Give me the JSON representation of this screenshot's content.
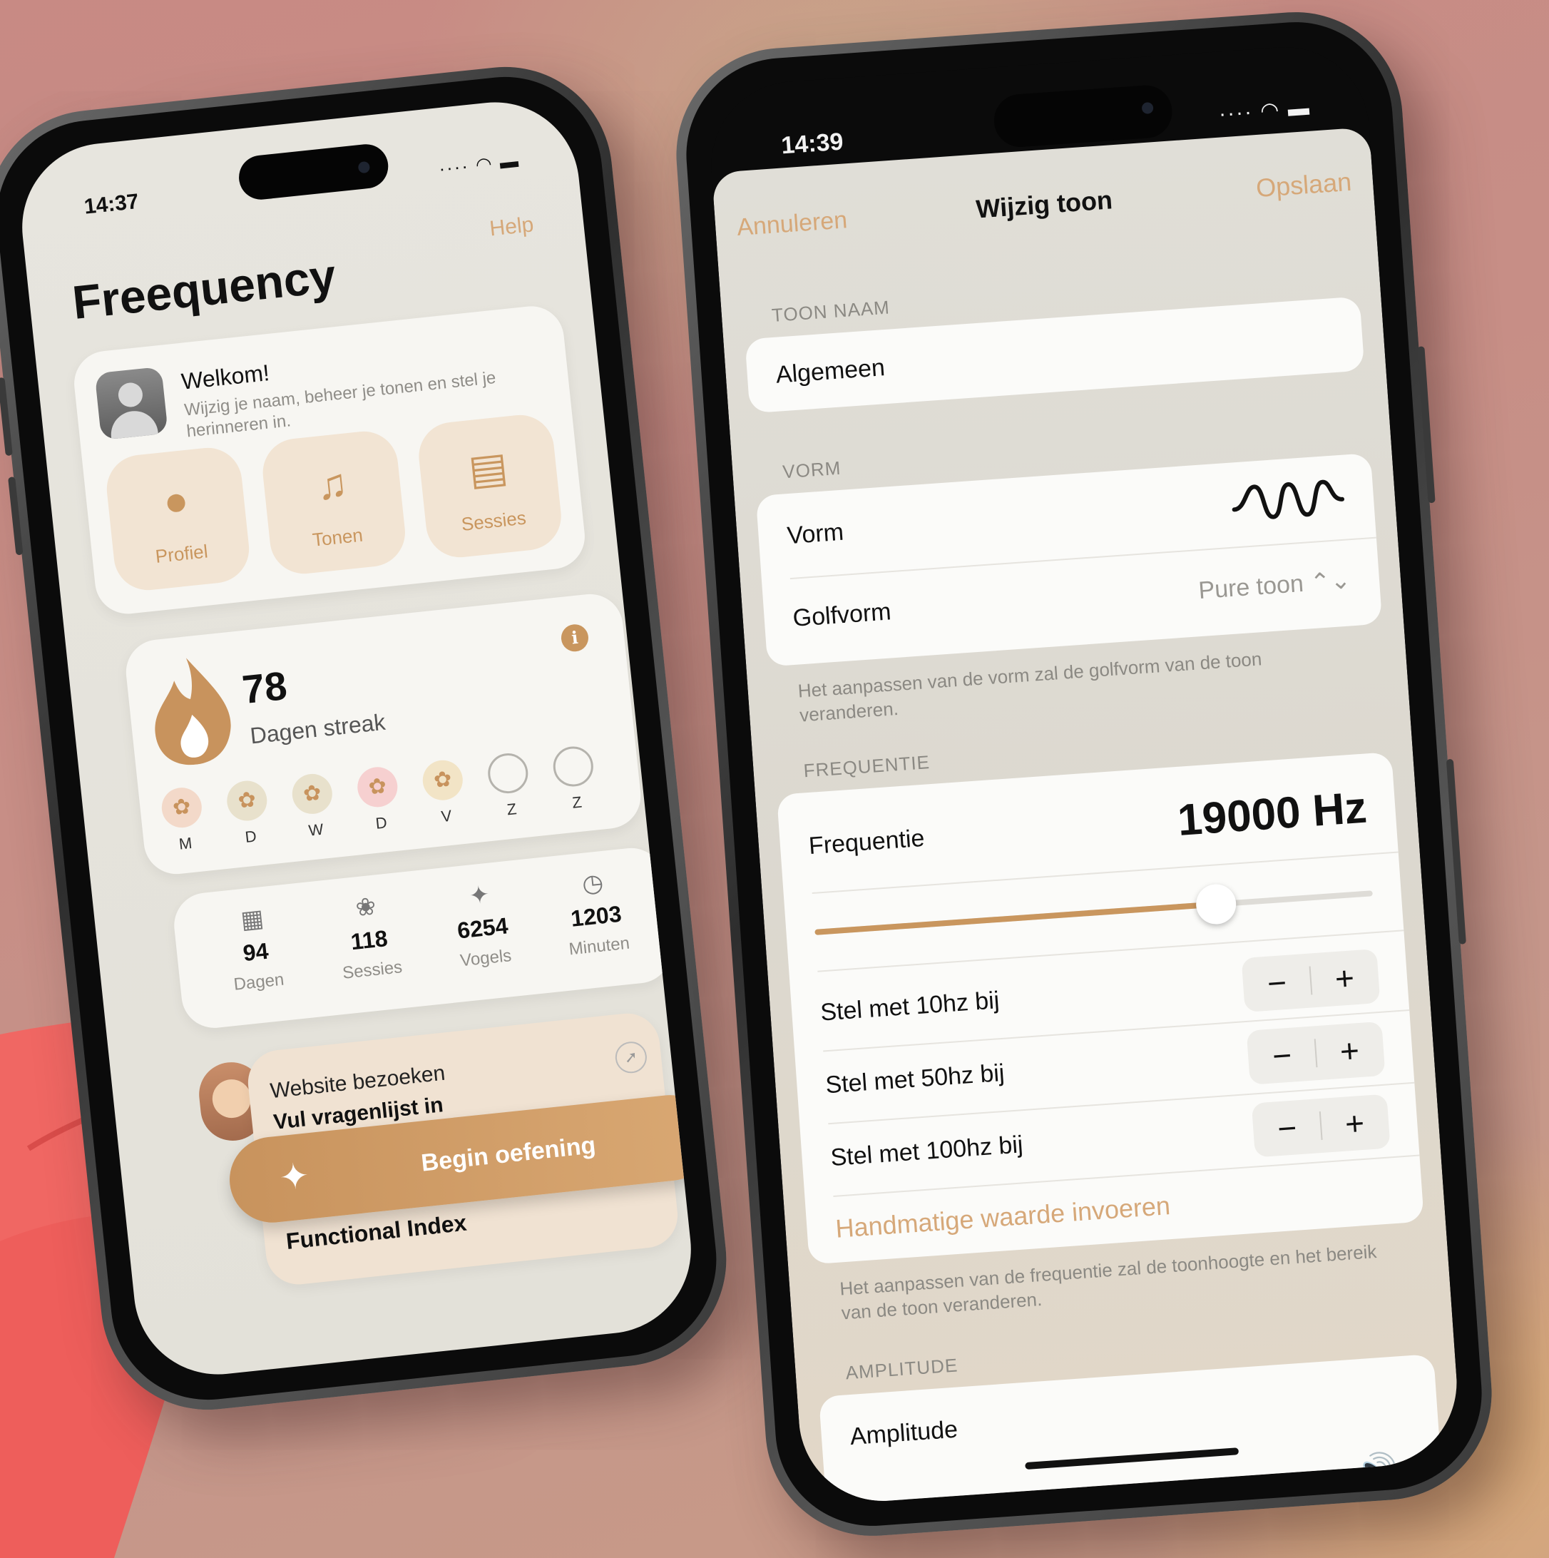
{
  "left_phone": {
    "status_time": "14:37",
    "help_label": "Help",
    "app_title": "Freequency",
    "welcome": {
      "title": "Welkom!",
      "subtitle": "Wijzig je naam, beheer je tonen en stel je herinneren in."
    },
    "tiles": [
      {
        "label": "Profiel",
        "icon": "person-icon"
      },
      {
        "label": "Tonen",
        "icon": "music-note-icon"
      },
      {
        "label": "Sessies",
        "icon": "stack-icon"
      }
    ],
    "streak": {
      "value": "78",
      "label": "Dagen streak",
      "info": "i"
    },
    "week_days": [
      {
        "label": "M",
        "state": "done",
        "color": "#f3d9c9"
      },
      {
        "label": "D",
        "state": "done",
        "color": "#e8e1cc"
      },
      {
        "label": "W",
        "state": "done",
        "color": "#e8e1cc"
      },
      {
        "label": "D",
        "state": "done",
        "color": "#f6d0d0"
      },
      {
        "label": "V",
        "state": "done",
        "color": "#f2e4c6"
      },
      {
        "label": "Z",
        "state": "empty"
      },
      {
        "label": "Z",
        "state": "empty"
      }
    ],
    "stats": [
      {
        "value": "94",
        "label": "Dagen",
        "icon": "calendar-icon"
      },
      {
        "value": "118",
        "label": "Sessies",
        "icon": "flower-icon"
      },
      {
        "value": "6254",
        "label": "Vogels",
        "icon": "bird-icon"
      },
      {
        "value": "1203",
        "label": "Minuten",
        "icon": "clock-icon"
      }
    ],
    "news": {
      "line1": "Website bezoeken",
      "line2": "Vul vragenlijst in",
      "line3": "Functional Index"
    },
    "begin_button": "Begin oefening"
  },
  "right_phone": {
    "status_time": "14:39",
    "nav": {
      "cancel": "Annuleren",
      "title": "Wijzig toon",
      "save": "Opslaan"
    },
    "toon_naam": {
      "header": "TOON NAAM",
      "value": "Algemeen"
    },
    "vorm": {
      "header": "VORM",
      "row_label": "Vorm",
      "golfvorm_label": "Golfvorm",
      "golfvorm_value": "Pure toon ⌃⌄",
      "note": "Het aanpassen van de vorm zal de golfvorm van de toon veranderen."
    },
    "frequentie": {
      "header": "FREQUENTIE",
      "label": "Frequentie",
      "value": "19000 Hz",
      "slider_fraction": 0.72,
      "steps": [
        {
          "label": "Stel met 10hz bij"
        },
        {
          "label": "Stel met 50hz bij"
        },
        {
          "label": "Stel met 100hz bij"
        }
      ],
      "manual": "Handmatige waarde invoeren",
      "note": "Het aanpassen van de frequentie zal de toonhoogte en het bereik van de toon veranderen."
    },
    "amplitude": {
      "header": "AMPLITUDE",
      "label": "Amplitude"
    },
    "stepper_minus": "−",
    "stepper_plus": "+"
  }
}
